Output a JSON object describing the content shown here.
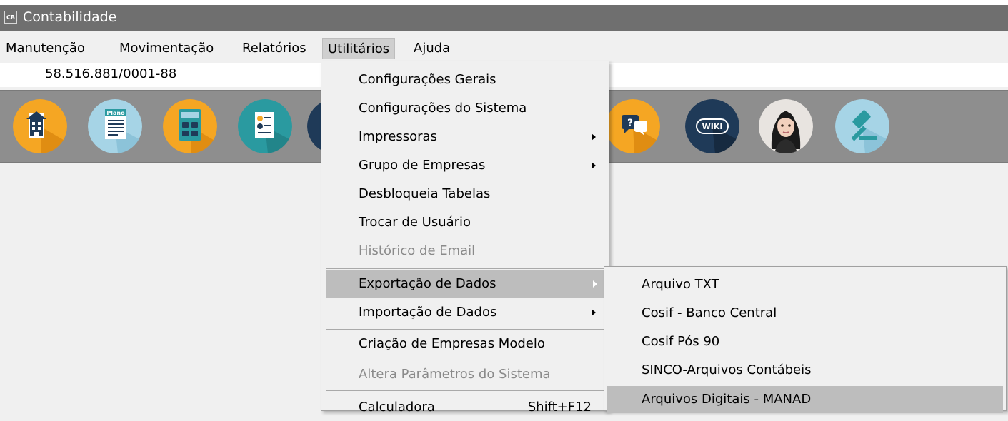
{
  "window": {
    "app_icon_text": "CB",
    "title": "Contabilidade"
  },
  "menubar": {
    "items": [
      {
        "label": "Manutenção"
      },
      {
        "label": "Movimentação"
      },
      {
        "label": "Relatórios"
      },
      {
        "label": "Utilitários",
        "active": true
      },
      {
        "label": "Ajuda"
      }
    ]
  },
  "infobar": {
    "cnpj": "58.516.881/0001-88"
  },
  "toolbar": {
    "buttons": [
      {
        "icon": "building-icon"
      },
      {
        "icon": "plano-document-icon",
        "text": "Plano"
      },
      {
        "icon": "calculator-icon"
      },
      {
        "icon": "report-chart-icon"
      },
      {
        "icon": "hidden-icon"
      },
      {
        "icon": "help-chat-icon"
      },
      {
        "icon": "wiki-icon",
        "text": "WIKI"
      },
      {
        "icon": "assistant-avatar-icon"
      },
      {
        "icon": "gavel-icon"
      }
    ]
  },
  "utilitarios_menu": {
    "items": [
      {
        "label": "Configurações Gerais"
      },
      {
        "label": "Configurações do Sistema"
      },
      {
        "label": "Impressoras",
        "submenu": true
      },
      {
        "label": "Grupo de Empresas",
        "submenu": true
      },
      {
        "label": "Desbloqueia Tabelas"
      },
      {
        "label": "Trocar de Usuário"
      },
      {
        "label": "Histórico de Email",
        "disabled": true
      },
      {
        "label": "Exportação de Dados",
        "submenu": true,
        "highlighted": true
      },
      {
        "label": "Importação de Dados",
        "submenu": true
      },
      {
        "label": "Criação de Empresas Modelo"
      },
      {
        "label": "Altera Parâmetros do Sistema",
        "disabled": true
      },
      {
        "label": "Calculadora",
        "shortcut": "Shift+F12"
      }
    ]
  },
  "exportacao_submenu": {
    "items": [
      {
        "label": "Arquivo TXT"
      },
      {
        "label": "Cosif - Banco Central"
      },
      {
        "label": "Cosif Pós 90"
      },
      {
        "label": "SINCO-Arquivos Contábeis"
      },
      {
        "label": "Arquivos Digitais - MANAD",
        "highlighted": true
      }
    ]
  },
  "colors": {
    "titlebar": "#6f6f6f",
    "toolbar": "#8e8e8e",
    "orange": "#f5a623",
    "teal": "#2a9aa0",
    "light_blue": "#a6d4e6",
    "navy": "#1f3a58",
    "highlight": "#bdbdbd"
  }
}
